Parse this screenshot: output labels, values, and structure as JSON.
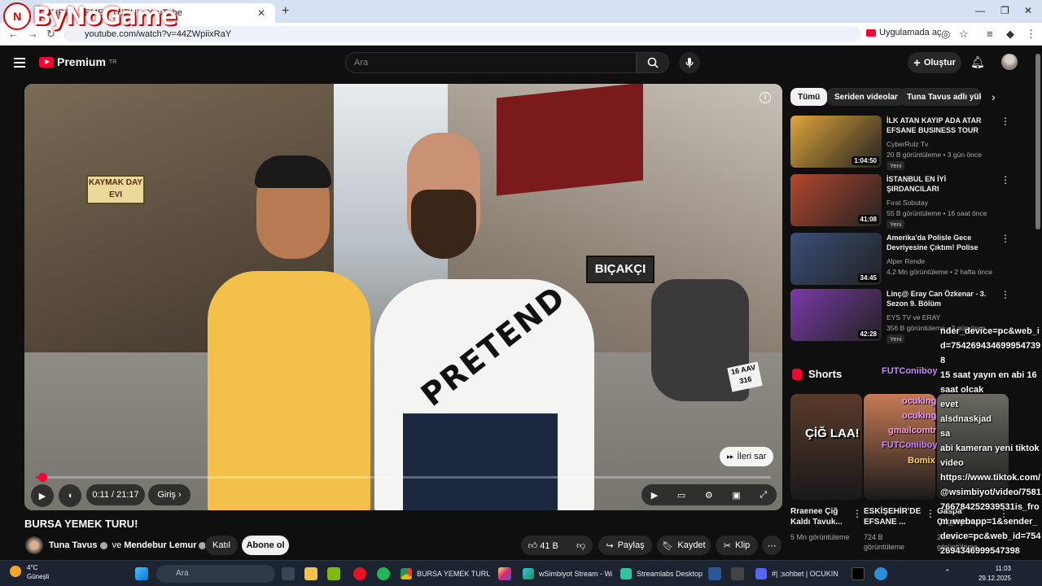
{
  "browser": {
    "tab_title": "BURSA YEMEK TURU! - YouTube",
    "new_tab": "+",
    "url": "youtube.com/watch?v=44ZWpiixRaY",
    "open_app": "Uygulamada aç"
  },
  "watermark": {
    "text": "ByNoGame"
  },
  "youtube": {
    "brand": "Premium",
    "brand_region": "TR",
    "search_placeholder": "Ara",
    "create_label": "Oluştur"
  },
  "player": {
    "time": "0:11 / 21:17",
    "chapter": "Giriş",
    "skip_label": "İleri sar",
    "progress_fraction": 0.0086,
    "sign_left": "KAYMAK DAY EVI",
    "sign_right": "BIÇAKÇI",
    "shirt_print": "PRETEND",
    "plate": "16 AAV 316"
  },
  "video": {
    "title": "BURSA YEMEK TURU!",
    "channel_a": "Tuna Tavus",
    "joiner": "ve",
    "channel_b": "Mendebur Lemur",
    "join_label": "Katıl",
    "subscribe_label": "Abone ol",
    "likes": "41 B",
    "share_label": "Paylaş",
    "save_label": "Kaydet",
    "clip_label": "Klip"
  },
  "chips": [
    "Tümü",
    "Seriden videolar",
    "Tuna Tavus adlı yükle"
  ],
  "recommendations": [
    {
      "title": "İLK ATAN KAYIP ADA ATAR EFSANE BUSINESS TOUR",
      "channel": "CyberRulz Tv",
      "meta": "20 B görüntüleme • 3 gün önce",
      "badge": "Yeni",
      "duration": "1:04:50",
      "thumb": "#e0a53a"
    },
    {
      "title": "İSTANBUL EN İYİ ŞIRDANCILARI DENEDİK!@Fat...",
      "channel": "Fırat Sobutay",
      "meta": "55 B görüntüleme • 16 saat önce",
      "badge": "Yeni",
      "duration": "41:08",
      "thumb": "#b5472f"
    },
    {
      "title": "Amerika'da Polisle Gece Devriyesine Çıktım! Polise Küf...",
      "channel": "Alper Rende",
      "meta": "4,2 Mn görüntüleme • 2 hafta önce",
      "badge": "",
      "duration": "34:45",
      "thumb": "#3a4f7a"
    },
    {
      "title": "Linç@ Eray Can Özkenar - 3. Sezon 9. Bölüm",
      "channel": "EYS TV ve ERAY",
      "meta": "356 B görüntüleme • 3 gün önce",
      "badge": "Yeni",
      "duration": "42:28",
      "thumb": "#7a3aa8"
    }
  ],
  "shorts": {
    "heading": "Shorts",
    "items": [
      {
        "title": "Rraenee Çiğ Kaldı Tavuk...",
        "views": "5 Mn görüntüleme",
        "caption": "ÇİĞ LAA!",
        "thumb": "#5a3a2a"
      },
      {
        "title": "ESKİŞEHİR'DE EFSANE ...",
        "views": "724 B görüntüleme",
        "caption": "",
        "thumb": "#c77a55"
      },
      {
        "title": "Gaspa Çıkmışsın ...",
        "views": "2,3 Mn görüntüleme",
        "caption": "",
        "thumb": "#6a6a62"
      }
    ]
  },
  "chat": {
    "lines": [
      "nder_device=pc&web_id=7542694346999547398",
      "15 saat yayın en abi 16 saat olcak",
      "evet",
      "alsdnaskjad",
      "sa",
      "abi kameran yeni tiktok video",
      "https://www.tiktok.com/@wsimbiyot/video/7581766784252939531is_from_webapp=1&sender_device=pc&web_id=7542694346999547398"
    ],
    "users": [
      "FUTConiiboy",
      "ocuking",
      "ocuking",
      "gmailcomtr",
      "FUTConiiboy",
      "Bomix"
    ]
  },
  "taskbar": {
    "weather_temp": "4°C",
    "weather_desc": "Güneşli",
    "search": "Ara",
    "apps": [
      "BURSA YEMEK TURU! - Y",
      "wSimbiyot Stream - Wa",
      "Streamlabs Desktop",
      "#| ;sohbet | OCUKIN"
    ],
    "time": "11:03",
    "date": "29.12.2025"
  }
}
